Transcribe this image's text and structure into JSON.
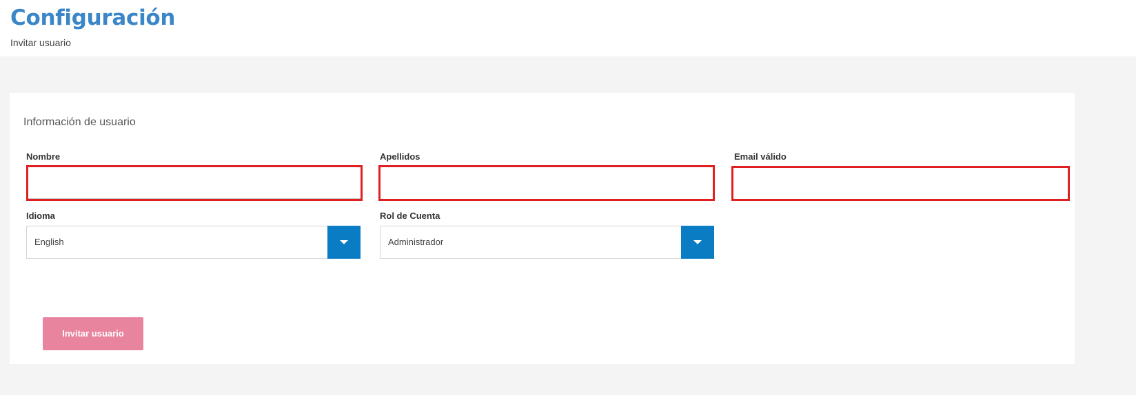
{
  "header": {
    "title": "Configuración",
    "subtitle": "Invitar usuario"
  },
  "form": {
    "section_title": "Información de usuario",
    "first_name": {
      "label": "Nombre",
      "value": "",
      "placeholder": ""
    },
    "last_name": {
      "label": "Apellidos",
      "value": "",
      "placeholder": ""
    },
    "email": {
      "label": "Email válido",
      "value": "",
      "placeholder": ""
    },
    "language": {
      "label": "Idioma",
      "selected": "English",
      "icon": "caret-down-icon"
    },
    "account_role": {
      "label": "Rol de Cuenta",
      "selected": "Administrador",
      "icon": "caret-down-icon"
    },
    "invite_button_label": "Invitar usuario"
  },
  "colors": {
    "title_blue": "#3a86c8",
    "select_button_blue": "#0a7cc4",
    "error_border_red": "#e02020",
    "invite_button_pink": "#e8849e",
    "background_gray": "#f3f4f3"
  }
}
